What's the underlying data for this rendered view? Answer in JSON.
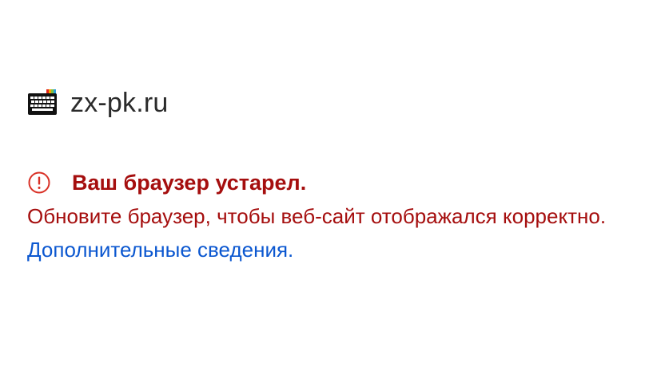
{
  "site": {
    "name": "zx-pk.ru",
    "logo_icon": "zx-keyboard-logo-icon"
  },
  "warning": {
    "icon": "error-circle-icon",
    "title": "Ваш браузер устарел.",
    "message": "Обновите браузер, чтобы веб-сайт отображался корректно.",
    "link_text": "Дополнительные сведения",
    "trailing": ".",
    "color": "#a50e0e",
    "link_color": "#0b57d0"
  }
}
